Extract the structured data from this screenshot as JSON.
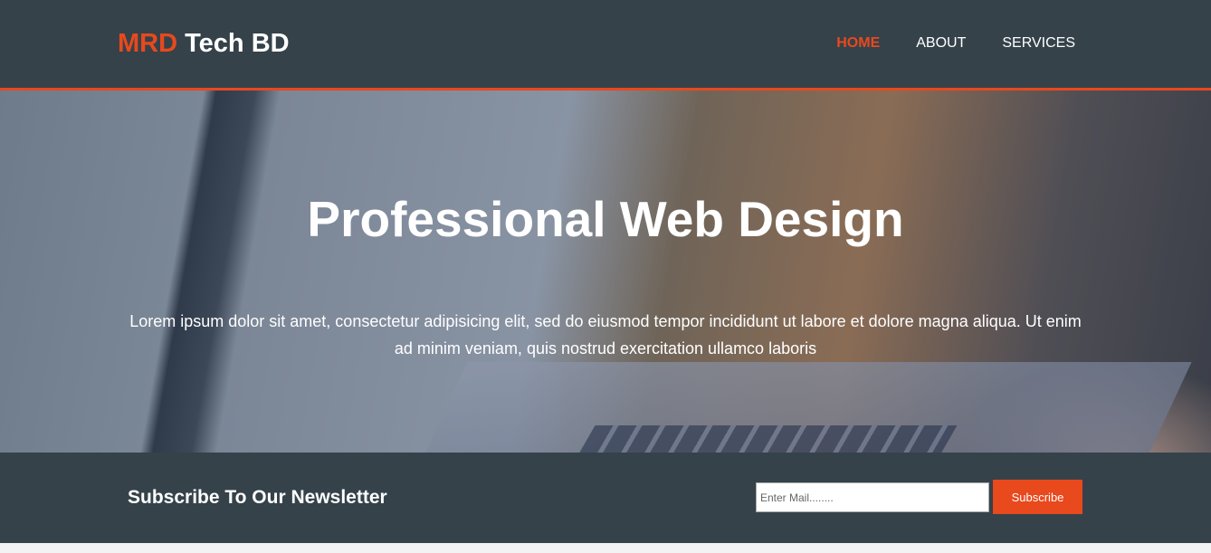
{
  "header": {
    "logo_highlight": "MRD",
    "logo_rest": " Tech BD",
    "nav": [
      "Home",
      "About",
      "Services"
    ],
    "accent": "#e8491d"
  },
  "hero": {
    "title": "Professional Web Design",
    "text": "Lorem ipsum dolor sit amet, consectetur adipisicing elit, sed do eiusmod tempor incididunt ut labore et dolore magna aliqua. Ut enim ad minim veniam, quis nostrud exercitation ullamco laboris"
  },
  "newsletter": {
    "title": "Subscribe To Our Newsletter",
    "placeholder": "Enter Mail........",
    "button": "Subscribe"
  }
}
